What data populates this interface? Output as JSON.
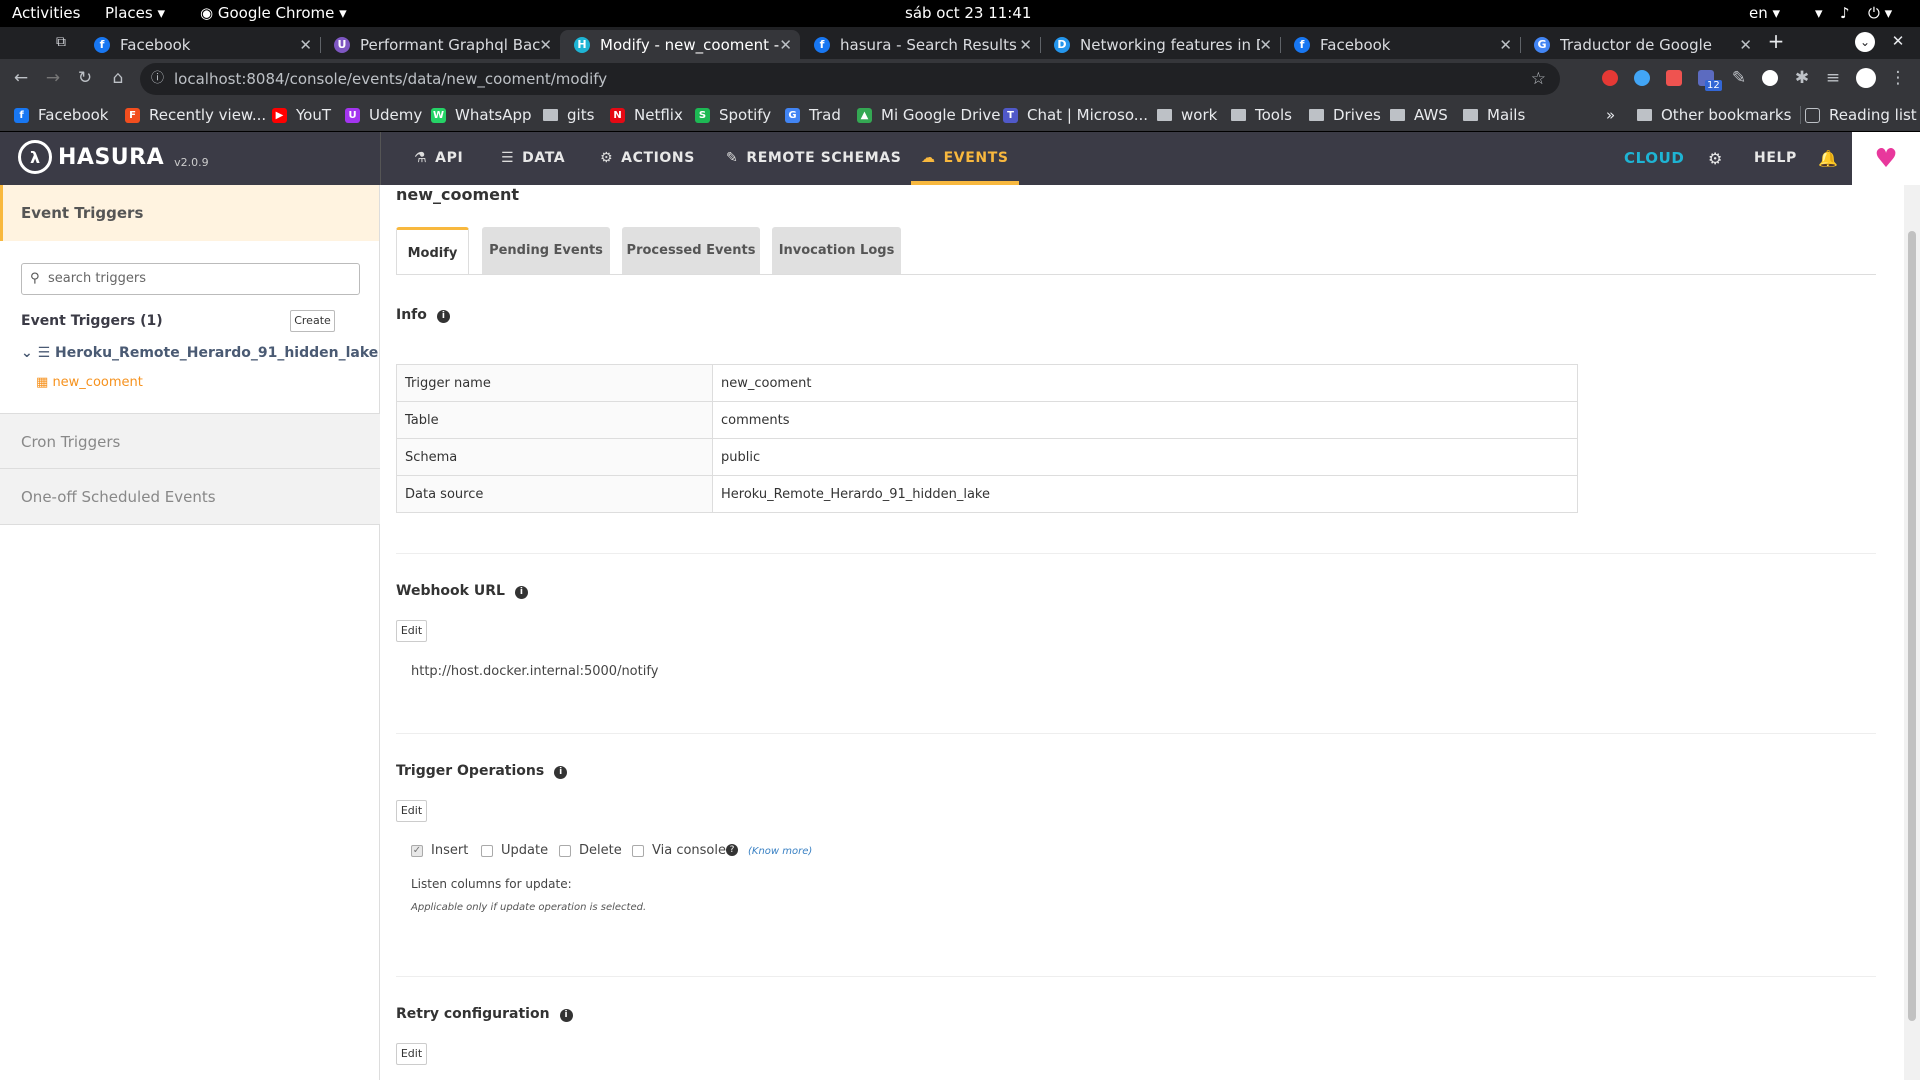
{
  "gnome": {
    "activities": "Activities",
    "places": "Places",
    "app": "Google Chrome",
    "clock": "sáb oct 23  11:41",
    "lang": "en"
  },
  "tabs": [
    {
      "title": "Facebook",
      "color": "#1877f2",
      "glyph": "f"
    },
    {
      "title": "Performant Graphql Backe",
      "color": "#7e57c2",
      "glyph": "U"
    },
    {
      "title": "Modify - new_cooment - E",
      "color": "#1eb4d4",
      "glyph": "H"
    },
    {
      "title": "hasura - Search Results | F",
      "color": "#1877f2",
      "glyph": "f"
    },
    {
      "title": "Networking features in D",
      "color": "#2496ed",
      "glyph": "D"
    },
    {
      "title": "Facebook",
      "color": "#1877f2",
      "glyph": "f"
    },
    {
      "title": "Traductor de Google",
      "color": "#4285f4",
      "glyph": "G"
    }
  ],
  "url": "localhost:8084/console/events/data/new_cooment/modify",
  "ext_badge": "12",
  "bookmarks": [
    {
      "label": "Facebook",
      "color": "#1877f2",
      "glyph": "f"
    },
    {
      "label": "Recently view...",
      "color": "#f24e1e",
      "glyph": "F"
    },
    {
      "label": "YouT",
      "color": "#ff0000",
      "glyph": "▶"
    },
    {
      "label": "Udemy",
      "color": "#a435f0",
      "glyph": "U"
    },
    {
      "label": "WhatsApp",
      "color": "#25d366",
      "glyph": "W"
    },
    {
      "label": "gits",
      "folder": true
    },
    {
      "label": "Netflix",
      "color": "#e50914",
      "glyph": "N"
    },
    {
      "label": "Spotify",
      "color": "#1db954",
      "glyph": "S"
    },
    {
      "label": "Trad",
      "color": "#4285f4",
      "glyph": "G"
    },
    {
      "label": "Mi Google Drive",
      "color": "#34a853",
      "glyph": "▲"
    },
    {
      "label": "Chat | Microso...",
      "color": "#5059c9",
      "glyph": "T"
    },
    {
      "label": "work",
      "folder": true
    },
    {
      "label": "Tools",
      "folder": true
    },
    {
      "label": "Drives",
      "folder": true
    },
    {
      "label": "AWS",
      "folder": true
    },
    {
      "label": "Mails",
      "folder": true
    }
  ],
  "bm_more": "»",
  "other_bookmarks": "Other bookmarks",
  "reading_list": "Reading list",
  "hasura": {
    "logo": "HASURA",
    "version": "v2.0.9",
    "nav": [
      "API",
      "DATA",
      "ACTIONS",
      "REMOTE SCHEMAS",
      "EVENTS"
    ],
    "cloud": "CLOUD",
    "help": "HELP"
  },
  "sidebar": {
    "heading": "Event Triggers",
    "search_placeholder": "search triggers",
    "count_label": "Event Triggers (1)",
    "create": "Create",
    "datasource": "Heroku_Remote_Herardo_91_hidden_lake",
    "trigger": "new_cooment",
    "cron": "Cron Triggers",
    "oneoff": "One-off Scheduled Events"
  },
  "main": {
    "title": "new_cooment",
    "tabs": [
      "Modify",
      "Pending Events",
      "Processed Events",
      "Invocation Logs"
    ],
    "info_heading": "Info",
    "info_rows": [
      [
        "Trigger name",
        "new_cooment"
      ],
      [
        "Table",
        "comments"
      ],
      [
        "Schema",
        "public"
      ],
      [
        "Data source",
        "Heroku_Remote_Herardo_91_hidden_lake"
      ]
    ],
    "webhook_heading": "Webhook URL",
    "edit": "Edit",
    "webhook_url": "http://host.docker.internal:5000/notify",
    "ops_heading": "Trigger Operations",
    "ops": [
      {
        "label": "Insert",
        "checked": true
      },
      {
        "label": "Update",
        "checked": false
      },
      {
        "label": "Delete",
        "checked": false
      },
      {
        "label": "Via console",
        "checked": false
      }
    ],
    "know_more": "(Know more)",
    "listen": "Listen columns for update:",
    "applicable": "Applicable only if update operation is selected.",
    "retry_heading": "Retry configuration"
  }
}
